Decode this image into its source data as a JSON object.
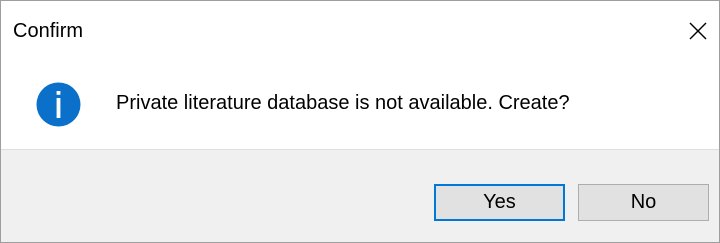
{
  "window": {
    "title": "Confirm",
    "close_icon": "close-icon"
  },
  "content": {
    "icon": "info-icon",
    "icon_color": "#0a70c9",
    "message": "Private literature database is not available. Create?"
  },
  "buttons": {
    "yes_label": "Yes",
    "no_label": "No",
    "default_border_color": "#0078d7"
  }
}
